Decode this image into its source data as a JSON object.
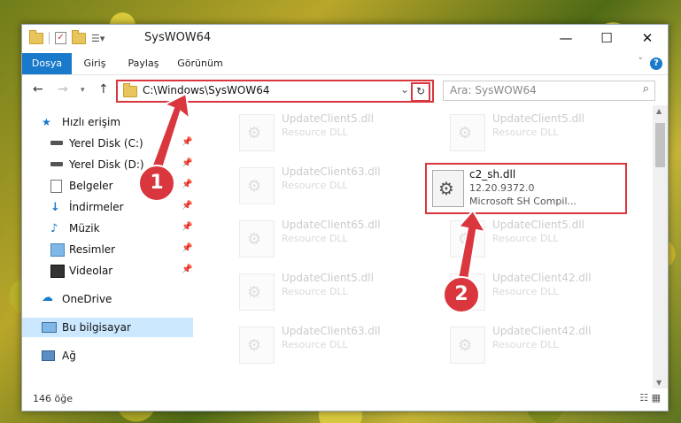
{
  "window": {
    "title": "SysWOW64",
    "minimize_icon": "minimize-icon",
    "maximize_icon": "maximize-icon",
    "close_icon": "close-icon"
  },
  "ribbon": {
    "tabs": [
      "Dosya",
      "Giriş",
      "Paylaş",
      "Görünüm"
    ],
    "help": "?"
  },
  "address": {
    "path": "C:\\Windows\\SysWOW64"
  },
  "search": {
    "placeholder": "Ara: SysWOW64"
  },
  "sidebar": {
    "quick_access": "Hızlı erişim",
    "items": [
      "Yerel Disk (C:)",
      "Yerel Disk (D:)",
      "Belgeler",
      "İndirmeler",
      "Müzik",
      "Resimler",
      "Videolar"
    ],
    "onedrive": "OneDrive",
    "this_pc": "Bu bilgisayar",
    "network": "Ağ"
  },
  "ghost_files": [
    {
      "name": "UpdateClient5.dll",
      "desc": "Resource DLL"
    },
    {
      "name": "UpdateClient5.dll",
      "desc": "Resource DLL"
    },
    {
      "name": "UpdateClient63.dll",
      "desc": "Resource DLL"
    },
    {
      "name": "UpdateClient65.dll",
      "desc": "Resource DLL"
    },
    {
      "name": "UpdateClient5.dll",
      "desc": "Resource DLL"
    },
    {
      "name": "UpdateClient5.dll",
      "desc": "Resource DLL"
    },
    {
      "name": "UpdateClient42.dll",
      "desc": "Resource DLL"
    },
    {
      "name": "UpdateClient63.dll",
      "desc": "Resource DLL"
    },
    {
      "name": "UpdateClient42.dll",
      "desc": "Resource DLL"
    }
  ],
  "selected_file": {
    "name": "c2_sh.dll",
    "version": "12.20.9372.0",
    "desc": "Microsoft SH Compil..."
  },
  "status": {
    "count": "146 öğe"
  },
  "callouts": {
    "one": "1",
    "two": "2"
  },
  "colors": {
    "accent": "#1979ca",
    "highlight": "#d9363e"
  }
}
